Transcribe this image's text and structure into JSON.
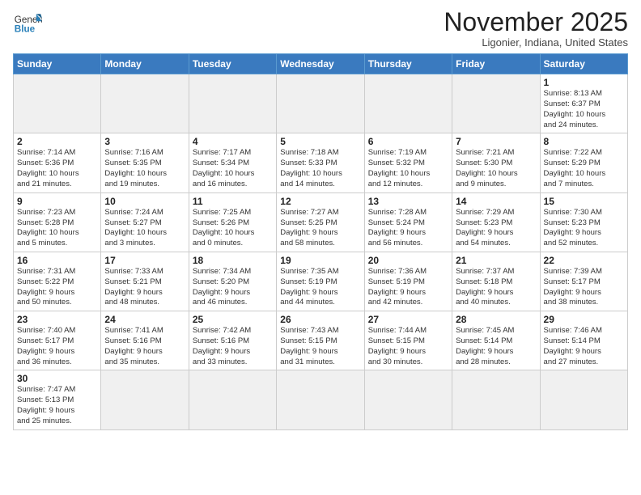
{
  "logo": {
    "text_general": "General",
    "text_blue": "Blue"
  },
  "header": {
    "month_year": "November 2025",
    "location": "Ligonier, Indiana, United States"
  },
  "weekdays": [
    "Sunday",
    "Monday",
    "Tuesday",
    "Wednesday",
    "Thursday",
    "Friday",
    "Saturday"
  ],
  "weeks": [
    [
      {
        "day": "",
        "info": "",
        "empty": true
      },
      {
        "day": "",
        "info": "",
        "empty": true
      },
      {
        "day": "",
        "info": "",
        "empty": true
      },
      {
        "day": "",
        "info": "",
        "empty": true
      },
      {
        "day": "",
        "info": "",
        "empty": true
      },
      {
        "day": "",
        "info": "",
        "empty": true
      },
      {
        "day": "1",
        "info": "Sunrise: 8:13 AM\nSunset: 6:37 PM\nDaylight: 10 hours\nand 24 minutes."
      }
    ],
    [
      {
        "day": "2",
        "info": "Sunrise: 7:14 AM\nSunset: 5:36 PM\nDaylight: 10 hours\nand 21 minutes."
      },
      {
        "day": "3",
        "info": "Sunrise: 7:16 AM\nSunset: 5:35 PM\nDaylight: 10 hours\nand 19 minutes."
      },
      {
        "day": "4",
        "info": "Sunrise: 7:17 AM\nSunset: 5:34 PM\nDaylight: 10 hours\nand 16 minutes."
      },
      {
        "day": "5",
        "info": "Sunrise: 7:18 AM\nSunset: 5:33 PM\nDaylight: 10 hours\nand 14 minutes."
      },
      {
        "day": "6",
        "info": "Sunrise: 7:19 AM\nSunset: 5:32 PM\nDaylight: 10 hours\nand 12 minutes."
      },
      {
        "day": "7",
        "info": "Sunrise: 7:21 AM\nSunset: 5:30 PM\nDaylight: 10 hours\nand 9 minutes."
      },
      {
        "day": "8",
        "info": "Sunrise: 7:22 AM\nSunset: 5:29 PM\nDaylight: 10 hours\nand 7 minutes."
      }
    ],
    [
      {
        "day": "9",
        "info": "Sunrise: 7:23 AM\nSunset: 5:28 PM\nDaylight: 10 hours\nand 5 minutes."
      },
      {
        "day": "10",
        "info": "Sunrise: 7:24 AM\nSunset: 5:27 PM\nDaylight: 10 hours\nand 3 minutes."
      },
      {
        "day": "11",
        "info": "Sunrise: 7:25 AM\nSunset: 5:26 PM\nDaylight: 10 hours\nand 0 minutes."
      },
      {
        "day": "12",
        "info": "Sunrise: 7:27 AM\nSunset: 5:25 PM\nDaylight: 9 hours\nand 58 minutes."
      },
      {
        "day": "13",
        "info": "Sunrise: 7:28 AM\nSunset: 5:24 PM\nDaylight: 9 hours\nand 56 minutes."
      },
      {
        "day": "14",
        "info": "Sunrise: 7:29 AM\nSunset: 5:23 PM\nDaylight: 9 hours\nand 54 minutes."
      },
      {
        "day": "15",
        "info": "Sunrise: 7:30 AM\nSunset: 5:23 PM\nDaylight: 9 hours\nand 52 minutes."
      }
    ],
    [
      {
        "day": "16",
        "info": "Sunrise: 7:31 AM\nSunset: 5:22 PM\nDaylight: 9 hours\nand 50 minutes."
      },
      {
        "day": "17",
        "info": "Sunrise: 7:33 AM\nSunset: 5:21 PM\nDaylight: 9 hours\nand 48 minutes."
      },
      {
        "day": "18",
        "info": "Sunrise: 7:34 AM\nSunset: 5:20 PM\nDaylight: 9 hours\nand 46 minutes."
      },
      {
        "day": "19",
        "info": "Sunrise: 7:35 AM\nSunset: 5:19 PM\nDaylight: 9 hours\nand 44 minutes."
      },
      {
        "day": "20",
        "info": "Sunrise: 7:36 AM\nSunset: 5:19 PM\nDaylight: 9 hours\nand 42 minutes."
      },
      {
        "day": "21",
        "info": "Sunrise: 7:37 AM\nSunset: 5:18 PM\nDaylight: 9 hours\nand 40 minutes."
      },
      {
        "day": "22",
        "info": "Sunrise: 7:39 AM\nSunset: 5:17 PM\nDaylight: 9 hours\nand 38 minutes."
      }
    ],
    [
      {
        "day": "23",
        "info": "Sunrise: 7:40 AM\nSunset: 5:17 PM\nDaylight: 9 hours\nand 36 minutes."
      },
      {
        "day": "24",
        "info": "Sunrise: 7:41 AM\nSunset: 5:16 PM\nDaylight: 9 hours\nand 35 minutes."
      },
      {
        "day": "25",
        "info": "Sunrise: 7:42 AM\nSunset: 5:16 PM\nDaylight: 9 hours\nand 33 minutes."
      },
      {
        "day": "26",
        "info": "Sunrise: 7:43 AM\nSunset: 5:15 PM\nDaylight: 9 hours\nand 31 minutes."
      },
      {
        "day": "27",
        "info": "Sunrise: 7:44 AM\nSunset: 5:15 PM\nDaylight: 9 hours\nand 30 minutes."
      },
      {
        "day": "28",
        "info": "Sunrise: 7:45 AM\nSunset: 5:14 PM\nDaylight: 9 hours\nand 28 minutes."
      },
      {
        "day": "29",
        "info": "Sunrise: 7:46 AM\nSunset: 5:14 PM\nDaylight: 9 hours\nand 27 minutes."
      }
    ],
    [
      {
        "day": "30",
        "info": "Sunrise: 7:47 AM\nSunset: 5:13 PM\nDaylight: 9 hours\nand 25 minutes.",
        "last": true
      },
      {
        "day": "",
        "info": "",
        "empty": true,
        "last": true
      },
      {
        "day": "",
        "info": "",
        "empty": true,
        "last": true
      },
      {
        "day": "",
        "info": "",
        "empty": true,
        "last": true
      },
      {
        "day": "",
        "info": "",
        "empty": true,
        "last": true
      },
      {
        "day": "",
        "info": "",
        "empty": true,
        "last": true
      },
      {
        "day": "",
        "info": "",
        "empty": true,
        "last": true
      }
    ]
  ]
}
